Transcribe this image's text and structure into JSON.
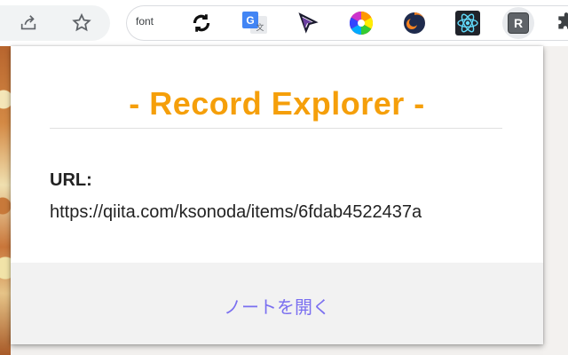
{
  "toolbar": {
    "icons": [
      "share-icon",
      "star-icon"
    ],
    "extensions": [
      {
        "name": "font-extension",
        "label": "font"
      },
      {
        "name": "sync-arrows-icon"
      },
      {
        "name": "google-translate-icon"
      },
      {
        "name": "cursor-arrow-icon"
      },
      {
        "name": "color-wheel-icon"
      },
      {
        "name": "crescent-logo-icon"
      },
      {
        "name": "react-atom-icon"
      },
      {
        "name": "record-explorer-icon",
        "label": "R"
      },
      {
        "name": "puzzle-icon"
      }
    ]
  },
  "popup": {
    "title": "- Record Explorer -",
    "url_label": "URL:",
    "url_value": "https://qiita.com/ksonoda/items/6fdab4522437a",
    "open_note_label": "ノートを開く"
  },
  "colors": {
    "title": "#f59f0a",
    "link": "#7a6ff0",
    "footer_bg": "#f2f2f2",
    "toolbar_bg": "#ffffff"
  }
}
